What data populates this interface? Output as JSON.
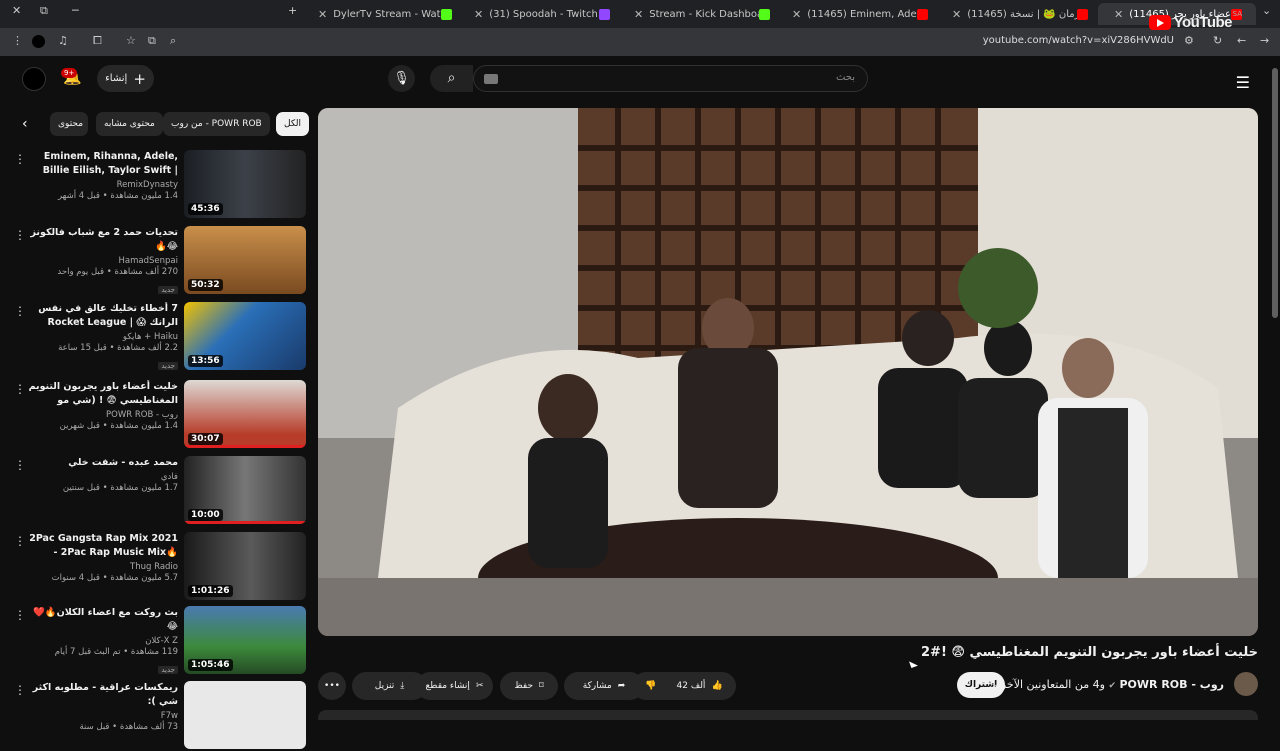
{
  "browser": {
    "tabs": [
      {
        "label": "DylerTv Stream - Watch Live on...",
        "color": "#53fc18"
      },
      {
        "label": "(31) Spoodah - Twitch",
        "color": "#9146ff"
      },
      {
        "label": "Stream - Kick Dashboard",
        "color": "#53fc18"
      },
      {
        "label": "(11465) Eminem, Adele, Ariana...",
        "color": "#ff0000"
      },
      {
        "label": "(11465) كشتة زمان 🐸 | نسخة ...",
        "color": "#ff0000"
      },
      {
        "label": "(11465) خليت أعضاء باور يجر...",
        "color": "#ff0000"
      }
    ],
    "url": "youtube.com/watch?v=xiV286HVWdU"
  },
  "header": {
    "logo_text": "YouTube",
    "region": "SA",
    "search_placeholder": "بحث",
    "create_label": "إنشاء",
    "notif_count": "9+"
  },
  "chips": [
    "الكل",
    "من روب - POWR ROB",
    "محتوى مشابه",
    "محتوى"
  ],
  "recommendations": [
    {
      "title": "Eminem, Rihanna, Adele, Billie Eilish, Taylor Swift | XL MIX ...",
      "channel": "RemixDynasty",
      "views": "1.4 مليون مشاهدة • قبل 4 أشهر",
      "duration": "45:36",
      "is_new": false,
      "thumb_color": "#2a2e33"
    },
    {
      "title": "تحديات حمد 2 مع شباب فالكونز 😂🔥",
      "channel": "HamadSenpai",
      "views": "270 ألف مشاهدة • قبل يوم واحد",
      "duration": "50:32",
      "is_new": true,
      "new_label": "جديد",
      "thumb_color": "#8a5a2a"
    },
    {
      "title": "7 أخطاء تخليك عالق في نفس الرانك 😱 | Rocket League (المسابح يتطلب لجنك...",
      "channel": "Haiku + هايكو",
      "views": "2.2 ألف مشاهدة • قبل 15 ساعة",
      "duration": "13:56",
      "is_new": true,
      "new_label": "جديد",
      "thumb_color": "#2a6fb8"
    },
    {
      "title": "خليت أعضاء باور يجربون التنويم المغناطيسي 😨 ! (شي مو طبيعي!!)",
      "channel": "روب - POWR ROB",
      "views": "1.4 مليون مشاهدة • قبل شهرين",
      "duration": "30:07",
      "is_new": false,
      "thumb_color": "#c9c6c2"
    },
    {
      "title": "محمد عبده - شفت خلي",
      "channel": "فادي",
      "views": "1.7 مليون مشاهدة • قبل سنتين",
      "duration": "10:00",
      "is_new": false,
      "thumb_color": "#3a3a3a"
    },
    {
      "title": "2Pac Gangsta Rap Mix 2021 - 2Pac Rap Music Mix🔥 Narcos...🔥",
      "channel": "Thug Radio",
      "views": "5.7 مليون مشاهدة • قبل 4 سنوات",
      "duration": "1:01:26",
      "is_new": false,
      "thumb_color": "#4a4a4a"
    },
    {
      "title": "بث روكت مع اعضاء الكلان🔥❤️😂",
      "channel": "X Z-كلان",
      "views": "119 مشاهدة • تم البث قبل 7 أيام",
      "duration": "1:05:46",
      "is_new": true,
      "new_label": "جديد",
      "thumb_color": "#3c6e3c"
    },
    {
      "title": "ريمكسات عراقية - مطلوبه اكثر شي ):",
      "channel": "F7w",
      "views": "73 ألف مشاهدة • قبل سنة",
      "duration": "",
      "is_new": false,
      "thumb_color": "#e8e8e8"
    }
  ],
  "video": {
    "title": "خليت أعضاء باور يجربون التنويم المغناطيسي 😨 !#2",
    "owner": "روب - POWR ROB",
    "collab": "و4 من المتعاونين الآخرين",
    "subscribe": "اشتراك",
    "likes": "42 ألف",
    "share": "مشاركة",
    "save": "حفظ",
    "clip": "إنشاء مقطع",
    "download": "تنزيل",
    "more": "•••"
  }
}
